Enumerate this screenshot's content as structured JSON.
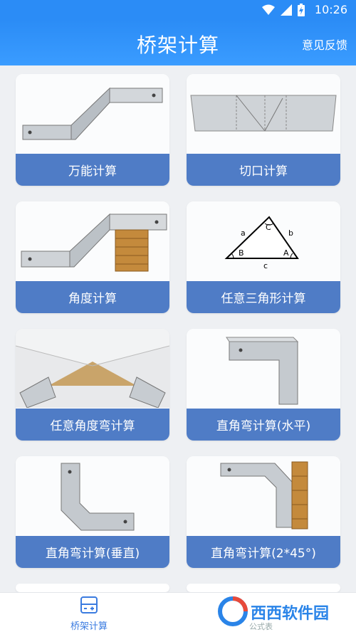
{
  "status_bar": {
    "time": "10:26",
    "icons": [
      "wifi-icon",
      "signal-icon",
      "battery-charging-icon"
    ]
  },
  "app_bar": {
    "title": "桥架计算",
    "feedback_label": "意见反馈"
  },
  "cards": [
    {
      "label": "万能计算",
      "icon": "universal-calc-illustration"
    },
    {
      "label": "切口计算",
      "icon": "cut-calc-illustration"
    },
    {
      "label": "角度计算",
      "icon": "angle-calc-illustration"
    },
    {
      "label": "任意三角形计算",
      "icon": "triangle-illustration",
      "triangle_labels": {
        "a": "a",
        "b": "b",
        "c": "c",
        "A": "A",
        "B": "B",
        "C": "C"
      }
    },
    {
      "label": "任意角度弯计算",
      "icon": "any-angle-bend-illustration"
    },
    {
      "label": "直角弯计算(水平)",
      "icon": "right-angle-horizontal-illustration"
    },
    {
      "label": "直角弯计算(垂直)",
      "icon": "right-angle-vertical-illustration"
    },
    {
      "label": "直角弯计算(2*45°)",
      "icon": "right-angle-2x45-illustration"
    }
  ],
  "bottom_nav": {
    "items": [
      {
        "label": "桥架计算",
        "icon": "calculator-icon",
        "active": true
      }
    ]
  },
  "watermark": {
    "text": "西西软件园",
    "sub": "公式表"
  },
  "colors": {
    "primary": "#2b8cf6",
    "card_label_bg": "#4f7cc6",
    "tab_active": "#3a7be0"
  }
}
